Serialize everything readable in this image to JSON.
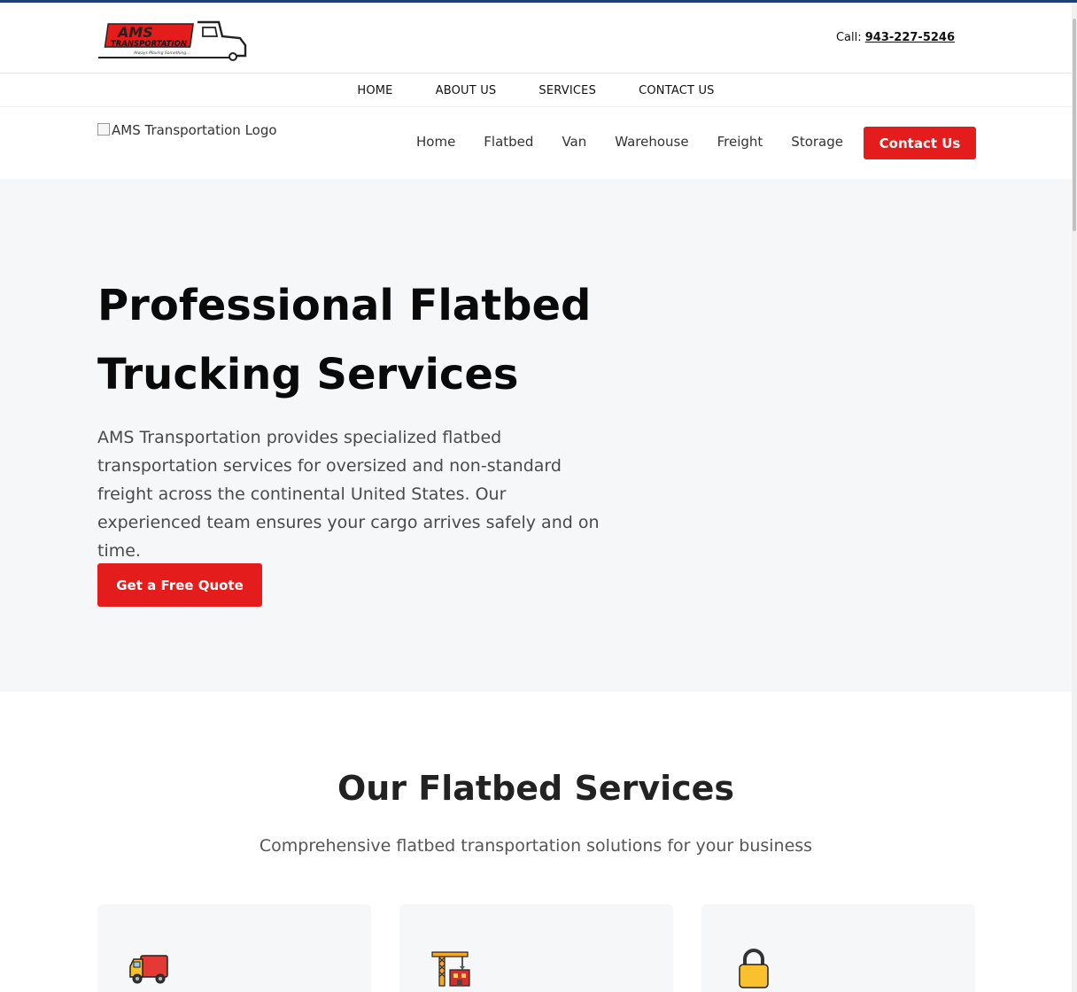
{
  "header": {
    "logo": {
      "wordmark": "AMS",
      "subline": "TRANSPORTATION",
      "tagline": "Always Moving Something..."
    },
    "call_label": "Call:",
    "phone": "943-227-5246"
  },
  "top_nav": [
    {
      "label": "HOME"
    },
    {
      "label": "ABOUT US"
    },
    {
      "label": "SERVICES"
    },
    {
      "label": "CONTACT US"
    }
  ],
  "main_nav": {
    "logo_alt": "AMS Transportation Logo",
    "links": [
      {
        "label": "Home"
      },
      {
        "label": "Flatbed"
      },
      {
        "label": "Van"
      },
      {
        "label": "Warehouse"
      },
      {
        "label": "Freight"
      },
      {
        "label": "Storage"
      }
    ],
    "contact_button": "Contact Us"
  },
  "hero": {
    "title_line1": "Professional Flatbed",
    "title_line2": "Trucking Services",
    "text": "AMS Transportation provides specialized flatbed transportation services for oversized and non-standard freight across the continental United States. Our experienced team ensures your cargo arrives safely and on time.",
    "cta": "Get a Free Quote"
  },
  "services": {
    "title": "Our Flatbed Services",
    "subtitle": "Comprehensive flatbed transportation solutions for your business",
    "cards": [
      {
        "icon": "truck-icon"
      },
      {
        "icon": "construction-crane-icon"
      },
      {
        "icon": "lock-icon"
      }
    ]
  },
  "colors": {
    "accent_red": "#e51c1c",
    "top_accent_blue": "#1f3f74",
    "hero_bg": "#f6f7f8"
  }
}
